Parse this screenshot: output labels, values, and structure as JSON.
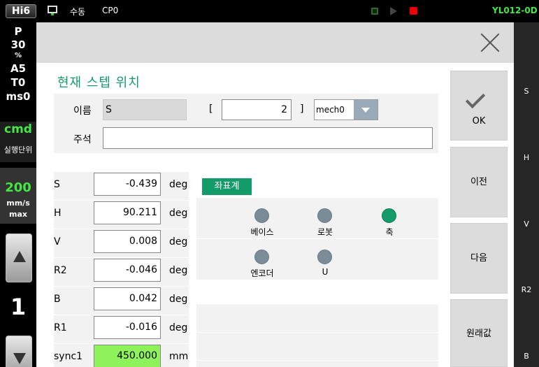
{
  "topbar": {
    "logo": "Hi6",
    "monitor_icon": "monitor-icon",
    "mode": "수동",
    "program": "CP0",
    "robot_id": "YL012-0D"
  },
  "left_panel": {
    "p_label": "P",
    "p_value": "30",
    "p_unit": "%",
    "a_value": "A5",
    "t_value": "T0",
    "ms_value": "ms0",
    "cmd": "cmd",
    "exec_unit": "실행단위",
    "speed": "200",
    "speed_unit": "mm/s",
    "speed_mode": "max",
    "step_number": "1"
  },
  "dialog": {
    "title": "현재 스텝 위치",
    "name_label": "이름",
    "name_value": "S",
    "bracket_open": "[",
    "index_value": "2",
    "bracket_close": "]",
    "mech_value": "mech0",
    "comment_label": "주석",
    "comment_value": "",
    "axes": [
      {
        "name": "S",
        "value": "-0.439",
        "unit": "deg"
      },
      {
        "name": "H",
        "value": "90.211",
        "unit": "deg"
      },
      {
        "name": "V",
        "value": "0.008",
        "unit": "deg"
      },
      {
        "name": "R2",
        "value": "-0.046",
        "unit": "deg"
      },
      {
        "name": "B",
        "value": "0.042",
        "unit": "deg"
      },
      {
        "name": "R1",
        "value": "-0.016",
        "unit": "deg"
      },
      {
        "name": "sync1",
        "value": "450.000",
        "unit": "mm"
      }
    ],
    "coord_title": "좌표계",
    "coord_options": [
      {
        "label": "베이스",
        "selected": false
      },
      {
        "label": "로봇",
        "selected": false
      },
      {
        "label": "축",
        "selected": true
      },
      {
        "label": "엔코더",
        "selected": false
      },
      {
        "label": "U",
        "selected": false
      }
    ],
    "buttons": {
      "ok": "OK",
      "prev": "이전",
      "next": "다음",
      "original": "원래값"
    }
  },
  "right_strip": {
    "labels": [
      "S",
      "H",
      "V",
      "R2",
      "B"
    ]
  },
  "colors": {
    "accent": "#149b6a",
    "selected_field": "#8ef35a",
    "robot_id": "#44e844",
    "record": "#e00000"
  }
}
